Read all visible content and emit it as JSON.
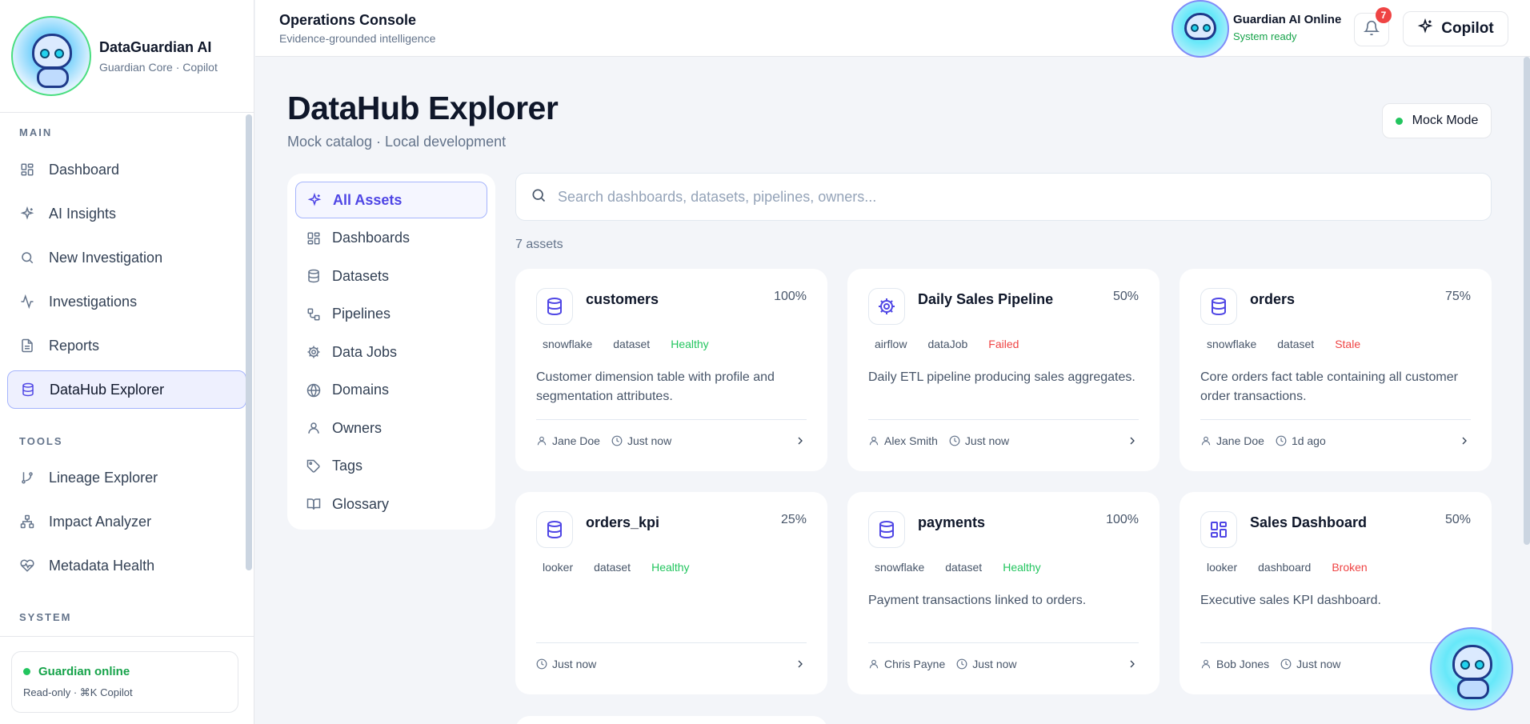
{
  "sidebar": {
    "brand_title": "DataGuardian AI",
    "brand_sub": "Guardian Core · Copilot",
    "sections": {
      "main": "MAIN",
      "tools": "TOOLS",
      "system": "SYSTEM"
    },
    "main_items": [
      {
        "label": "Dashboard",
        "icon": "dashboard-icon"
      },
      {
        "label": "AI Insights",
        "icon": "sparkles-icon"
      },
      {
        "label": "New Investigation",
        "icon": "search-icon"
      },
      {
        "label": "Investigations",
        "icon": "activity-icon"
      },
      {
        "label": "Reports",
        "icon": "document-icon"
      },
      {
        "label": "DataHub Explorer",
        "icon": "database-icon",
        "active": true
      }
    ],
    "tools_items": [
      {
        "label": "Lineage Explorer",
        "icon": "git-branch-icon"
      },
      {
        "label": "Impact Analyzer",
        "icon": "network-icon"
      },
      {
        "label": "Metadata Health",
        "icon": "heart-pulse-icon"
      }
    ],
    "status": {
      "label": "Guardian online",
      "sub": "Read-only · ⌘K Copilot"
    }
  },
  "header": {
    "title": "Operations Console",
    "subtitle": "Evidence-grounded intelligence",
    "guardian_title": "Guardian AI Online",
    "guardian_status": "System ready",
    "notification_count": "7",
    "copilot_label": "Copilot"
  },
  "main": {
    "title": "DataHub Explorer",
    "subtitle": "Mock catalog · Local development",
    "mode_label": "Mock Mode",
    "search_placeholder": "Search dashboards, datasets, pipelines, owners...",
    "asset_count": "7 assets",
    "filters": [
      {
        "label": "All Assets",
        "icon": "sparkles-icon",
        "active": true
      },
      {
        "label": "Dashboards",
        "icon": "dashboard-icon"
      },
      {
        "label": "Datasets",
        "icon": "database-icon"
      },
      {
        "label": "Pipelines",
        "icon": "pipeline-icon"
      },
      {
        "label": "Data Jobs",
        "icon": "gear-icon"
      },
      {
        "label": "Domains",
        "icon": "globe-icon"
      },
      {
        "label": "Owners",
        "icon": "user-icon"
      },
      {
        "label": "Tags",
        "icon": "tag-icon"
      },
      {
        "label": "Glossary",
        "icon": "book-icon"
      }
    ],
    "assets": [
      {
        "name": "customers",
        "pct": "100%",
        "icon": "database-icon",
        "platform": "snowflake",
        "type": "dataset",
        "status": "Healthy",
        "status_kind": "healthy",
        "desc": "Customer dimension table with profile and segmentation attributes.",
        "owner": "Jane Doe",
        "updated": "Just now"
      },
      {
        "name": "Daily Sales Pipeline",
        "pct": "50%",
        "icon": "gear-icon",
        "platform": "airflow",
        "type": "dataJob",
        "status": "Failed",
        "status_kind": "failed",
        "desc": "Daily ETL pipeline producing sales aggregates.",
        "owner": "Alex Smith",
        "updated": "Just now"
      },
      {
        "name": "orders",
        "pct": "75%",
        "icon": "database-icon",
        "platform": "snowflake",
        "type": "dataset",
        "status": "Stale",
        "status_kind": "stale",
        "desc": "Core orders fact table containing all customer order transactions.",
        "owner": "Jane Doe",
        "updated": "1d ago"
      },
      {
        "name": "orders_kpi",
        "pct": "25%",
        "icon": "database-icon",
        "platform": "looker",
        "type": "dataset",
        "status": "Healthy",
        "status_kind": "healthy",
        "desc": "",
        "owner": "",
        "updated": "Just now"
      },
      {
        "name": "payments",
        "pct": "100%",
        "icon": "database-icon",
        "platform": "snowflake",
        "type": "dataset",
        "status": "Healthy",
        "status_kind": "healthy",
        "desc": "Payment transactions linked to orders.",
        "owner": "Chris Payne",
        "updated": "Just now"
      },
      {
        "name": "Sales Dashboard",
        "pct": "50%",
        "icon": "dashboard-icon",
        "platform": "looker",
        "type": "dashboard",
        "status": "Broken",
        "status_kind": "broken",
        "desc": "Executive sales KPI dashboard.",
        "owner": "Bob Jones",
        "updated": "Just now"
      }
    ]
  }
}
